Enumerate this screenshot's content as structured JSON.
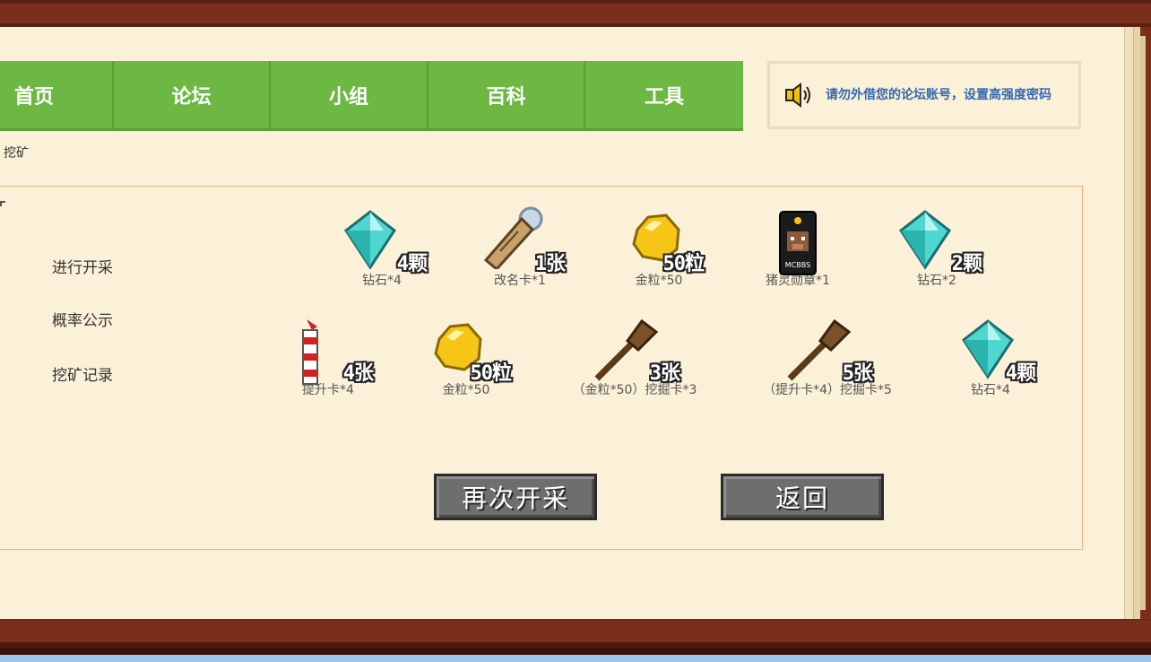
{
  "nav": {
    "items": [
      {
        "label": "首页"
      },
      {
        "label": "论坛"
      },
      {
        "label": "小组"
      },
      {
        "label": "百科"
      },
      {
        "label": "工具"
      }
    ]
  },
  "notice": {
    "text": "请勿外借您的论坛账号，设置高强度密码"
  },
  "breadcrumb": {
    "current": "挖矿"
  },
  "menu": {
    "items": [
      {
        "label": "进行开采"
      },
      {
        "label": "概率公示"
      },
      {
        "label": "挖矿记录"
      }
    ]
  },
  "rewards": {
    "row1": [
      {
        "icon": "diamond-icon",
        "count": "4颗",
        "label": "钻石*4"
      },
      {
        "icon": "rename-card-icon",
        "count": "1张",
        "label": "改名卡*1"
      },
      {
        "icon": "gold-nugget-icon",
        "count": "50粒",
        "label": "金粒*50"
      },
      {
        "icon": "pig-badge-icon",
        "count": "",
        "label": "猪灵勋章*1",
        "badge_text": "MCBBS"
      },
      {
        "icon": "diamond-icon",
        "count": "2颗",
        "label": "钻石*2"
      }
    ],
    "row2": [
      {
        "icon": "firework-icon",
        "count": "4张",
        "label": "提升卡*4"
      },
      {
        "icon": "gold-nugget-icon",
        "count": "50粒",
        "label": "金粒*50"
      },
      {
        "icon": "shovel-icon",
        "count": "3张",
        "label": "（金粒*50）挖掘卡*3"
      },
      {
        "icon": "shovel-icon",
        "count": "5张",
        "label": "（提升卡*4）挖掘卡*5"
      },
      {
        "icon": "diamond-icon",
        "count": "4颗",
        "label": "钻石*4"
      }
    ]
  },
  "buttons": {
    "mine_again": "再次开采",
    "back": "返回"
  },
  "colors": {
    "nav_green": "#6db843",
    "frame_brown": "#7b2f1b",
    "page_bg": "#fbf1d8",
    "notice_blue": "#3569b0"
  }
}
